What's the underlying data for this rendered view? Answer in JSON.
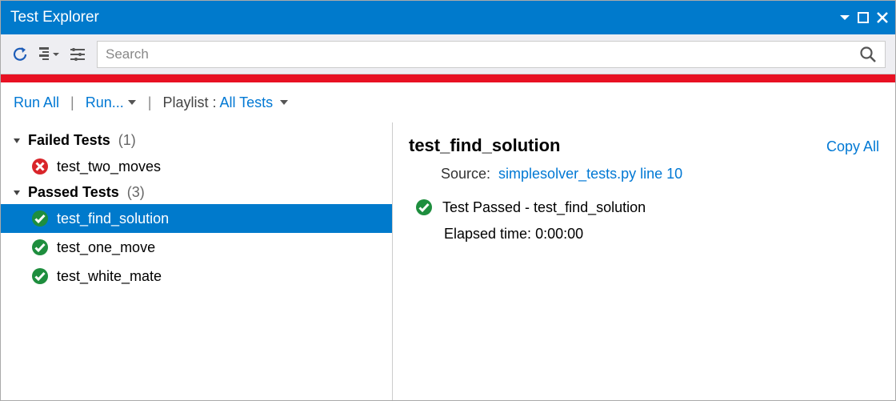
{
  "window": {
    "title": "Test Explorer"
  },
  "search": {
    "placeholder": "Search"
  },
  "actions": {
    "run_all": "Run All",
    "run": "Run...",
    "playlist_label": "Playlist :",
    "playlist_value": "All Tests"
  },
  "tree": {
    "failed": {
      "label": "Failed Tests",
      "count": "(1)",
      "items": [
        {
          "name": "test_two_moves"
        }
      ]
    },
    "passed": {
      "label": "Passed Tests",
      "count": "(3)",
      "items": [
        {
          "name": "test_find_solution",
          "selected": true
        },
        {
          "name": "test_one_move"
        },
        {
          "name": "test_white_mate"
        }
      ]
    }
  },
  "detail": {
    "title": "test_find_solution",
    "copy_all": "Copy All",
    "source_label": "Source:",
    "source_link": "simplesolver_tests.py line 10",
    "result": "Test Passed - test_find_solution",
    "elapsed_label": "Elapsed time:",
    "elapsed_value": "0:00:00"
  }
}
